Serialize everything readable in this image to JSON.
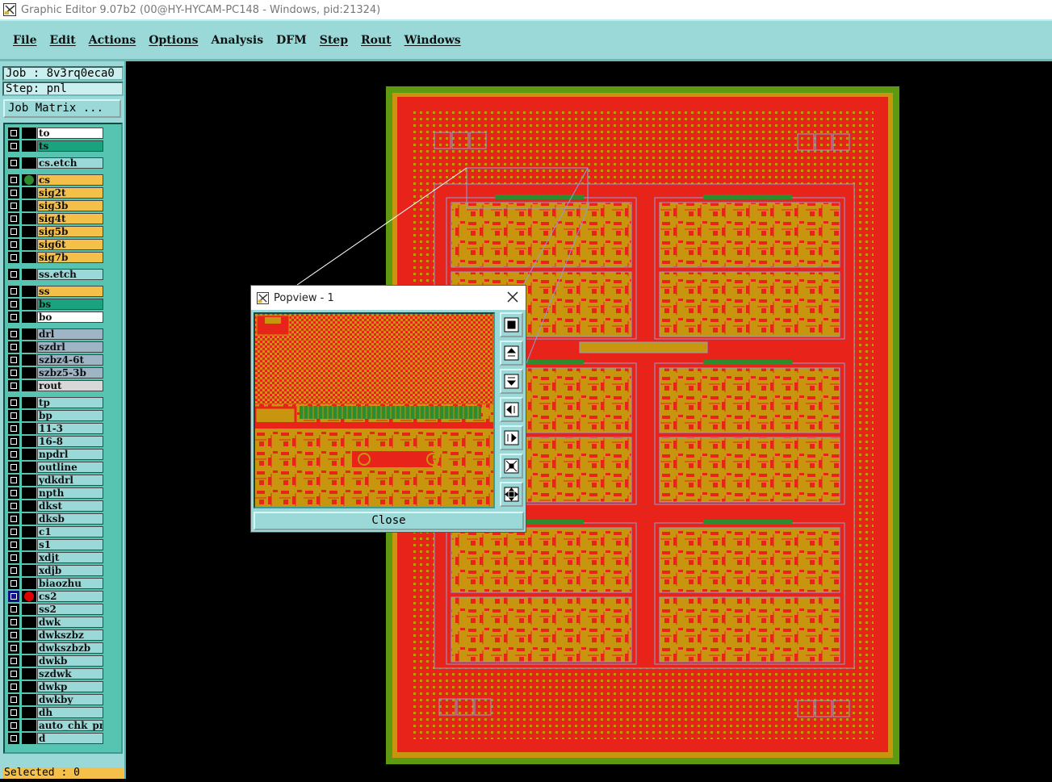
{
  "window": {
    "title": "Graphic Editor 9.07b2 (00@HY-HYCAM-PC148 - Windows, pid:21324)"
  },
  "menu": [
    "File",
    "Edit",
    "Actions",
    "Options",
    "Analysis",
    "DFM",
    "Step",
    "Rout",
    "Windows"
  ],
  "job": {
    "job_label": "Job : 8v3rq0eca0",
    "step_label": "Step: pnl",
    "matrix_button": "Job Matrix ..."
  },
  "layers": [
    {
      "name": "to",
      "color": "#ffffff"
    },
    {
      "name": "ts",
      "color": "#1aa37f"
    },
    {
      "name": "cs.etch",
      "color": "#9bd9d8"
    },
    {
      "name": "cs",
      "color": "#f5c04a",
      "active": true,
      "dot": "#2e8b2e"
    },
    {
      "name": "sig2t",
      "color": "#f5c04a"
    },
    {
      "name": "sig3b",
      "color": "#f5c04a"
    },
    {
      "name": "sig4t",
      "color": "#f5c04a"
    },
    {
      "name": "sig5b",
      "color": "#f5c04a"
    },
    {
      "name": "sig6t",
      "color": "#f5c04a"
    },
    {
      "name": "sig7b",
      "color": "#f5c04a"
    },
    {
      "name": "ss.etch",
      "color": "#9bd9d8"
    },
    {
      "name": "ss",
      "color": "#f5c04a"
    },
    {
      "name": "bs",
      "color": "#1aa37f"
    },
    {
      "name": "bo",
      "color": "#ffffff"
    },
    {
      "name": "drl",
      "color": "#9fb4c4"
    },
    {
      "name": "szdrl",
      "color": "#9fb4c4"
    },
    {
      "name": "szbz4-6t",
      "color": "#9fb4c4"
    },
    {
      "name": "szbz5-3b",
      "color": "#9fb4c4"
    },
    {
      "name": "rout",
      "color": "#d8d8d8"
    },
    {
      "name": "tp",
      "color": "#9bd9d8"
    },
    {
      "name": "bp",
      "color": "#9bd9d8"
    },
    {
      "name": "11-3",
      "color": "#9bd9d8"
    },
    {
      "name": "16-8",
      "color": "#9bd9d8"
    },
    {
      "name": "npdrl",
      "color": "#9bd9d8"
    },
    {
      "name": "outline",
      "color": "#9bd9d8"
    },
    {
      "name": "ydkdrl",
      "color": "#9bd9d8"
    },
    {
      "name": "npth",
      "color": "#9bd9d8"
    },
    {
      "name": "dkst",
      "color": "#9bd9d8"
    },
    {
      "name": "dksb",
      "color": "#9bd9d8"
    },
    {
      "name": "c1",
      "color": "#9bd9d8"
    },
    {
      "name": "s1",
      "color": "#9bd9d8"
    },
    {
      "name": "xdjt",
      "color": "#9bd9d8"
    },
    {
      "name": "xdjb",
      "color": "#9bd9d8"
    },
    {
      "name": "biaozhu",
      "color": "#9bd9d8"
    },
    {
      "name": "cs2",
      "color": "#9bd9d8",
      "selected": true,
      "dot": "#e00000"
    },
    {
      "name": "ss2",
      "color": "#9bd9d8"
    },
    {
      "name": "dwk",
      "color": "#9bd9d8"
    },
    {
      "name": "dwkszbz",
      "color": "#9bd9d8"
    },
    {
      "name": "dwkszbzb",
      "color": "#9bd9d8"
    },
    {
      "name": "dwkb",
      "color": "#9bd9d8"
    },
    {
      "name": "szdwk",
      "color": "#9bd9d8"
    },
    {
      "name": "dwkp",
      "color": "#9bd9d8"
    },
    {
      "name": "dwkby",
      "color": "#9bd9d8"
    },
    {
      "name": "dh",
      "color": "#9bd9d8"
    },
    {
      "name": "auto_chk_pn",
      "color": "#9bd9d8"
    },
    {
      "name": "d",
      "color": "#9bd9d8"
    }
  ],
  "status": {
    "selected": "Selected : 0"
  },
  "popview": {
    "title": "Popview - 1",
    "close_label": "Close",
    "tools": [
      "zoom-fit-icon",
      "pan-up-icon",
      "pan-down-icon",
      "pan-left-icon",
      "pan-right-icon",
      "zoom-in-icon",
      "zoom-out-icon"
    ]
  },
  "colors": {
    "panel": "#9bd9d8",
    "copper_red": "#e8231a",
    "copper_gold": "#c7960e",
    "border_green": "#5d9a12"
  }
}
